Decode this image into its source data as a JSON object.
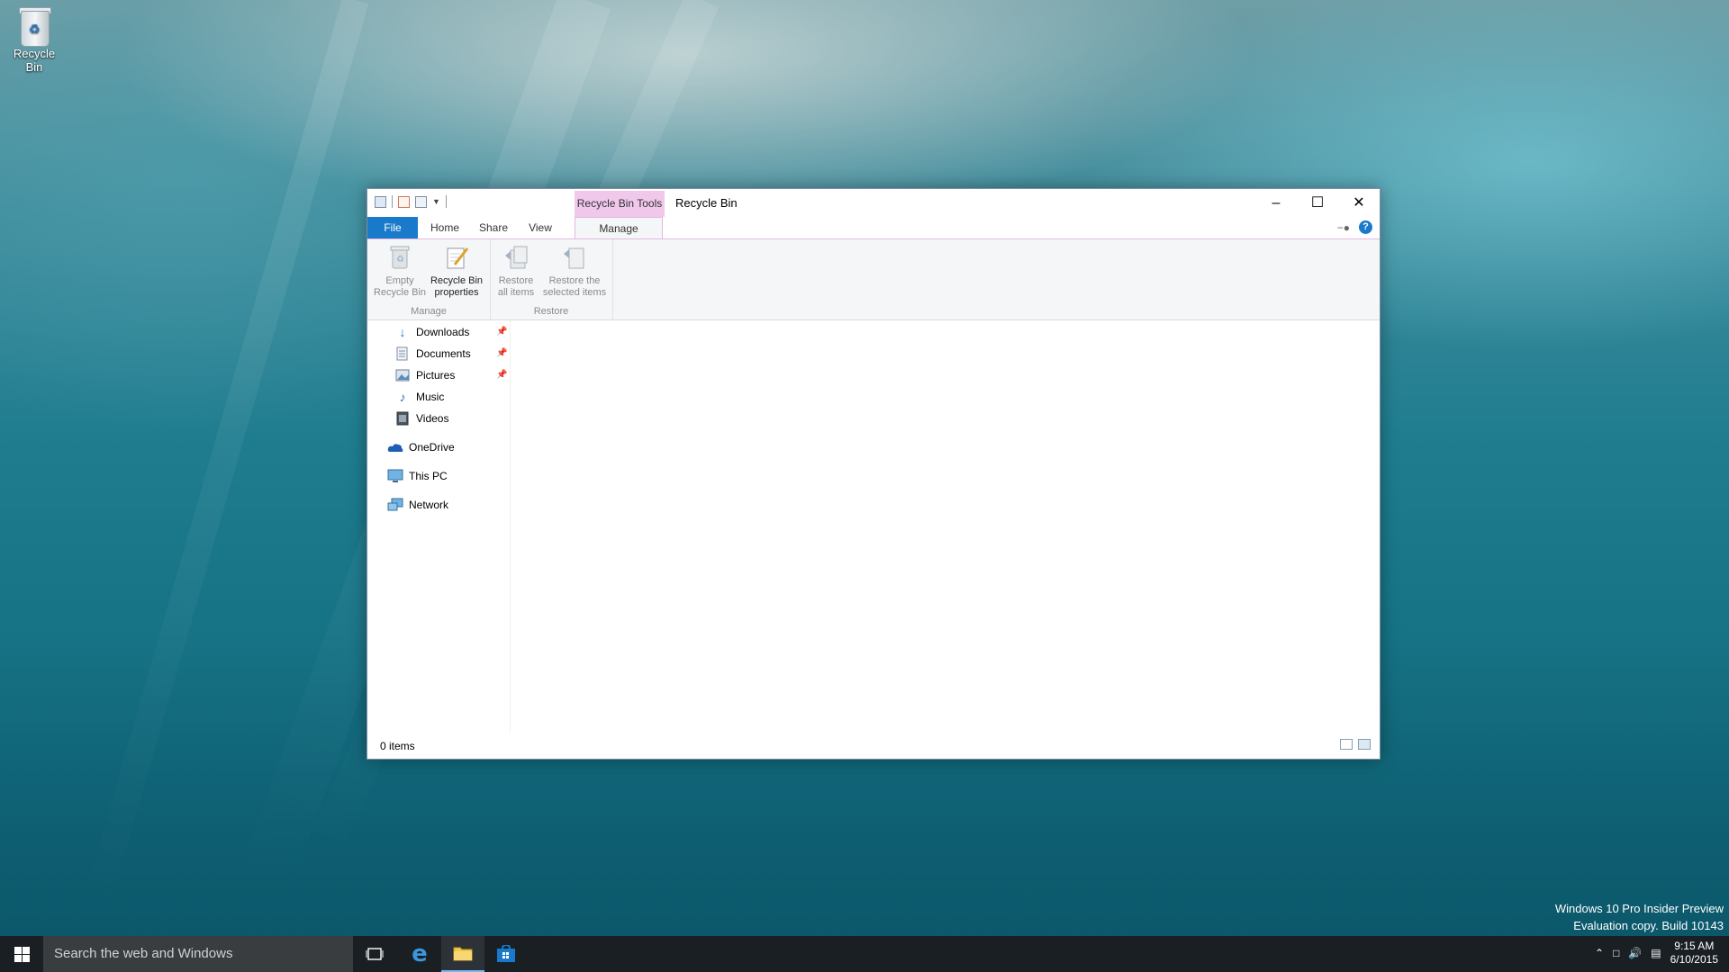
{
  "desktop": {
    "recycle_bin_label": "Recycle Bin",
    "watermark_line1": "Windows 10 Pro Insider Preview",
    "watermark_line2": "Evaluation copy. Build 10143"
  },
  "window": {
    "title": "Recycle Bin",
    "contextual_tab_group": "Recycle Bin Tools",
    "tabs": [
      "File",
      "Home",
      "Share",
      "View",
      "Manage"
    ],
    "help_label": "?",
    "ribbon": {
      "groups": [
        {
          "label": "Manage",
          "buttons": [
            {
              "line1": "Empty",
              "line2": "Recycle Bin",
              "enabled": false
            },
            {
              "line1": "Recycle Bin",
              "line2": "properties",
              "enabled": true
            }
          ]
        },
        {
          "label": "Restore",
          "buttons": [
            {
              "line1": "Restore",
              "line2": "all items",
              "enabled": false
            },
            {
              "line1": "Restore the",
              "line2": "selected items",
              "enabled": false
            }
          ]
        }
      ]
    },
    "nav": {
      "quick_access": [
        {
          "label": "Downloads",
          "icon": "download-arrow-icon",
          "pinned": true
        },
        {
          "label": "Documents",
          "icon": "documents-icon",
          "pinned": true
        },
        {
          "label": "Pictures",
          "icon": "pictures-icon",
          "pinned": true
        },
        {
          "label": "Music",
          "icon": "music-note-icon",
          "pinned": false
        },
        {
          "label": "Videos",
          "icon": "videos-icon",
          "pinned": false
        }
      ],
      "onedrive": "OneDrive",
      "this_pc": "This PC",
      "network": "Network"
    },
    "status": {
      "item_count": "0 items"
    }
  },
  "taskbar": {
    "search_placeholder": "Search the web and Windows",
    "time": "9:15 AM",
    "date": "6/10/2015"
  },
  "colors": {
    "accent": "#1979ca",
    "contextual_tab": "#f0c8ec",
    "taskbar": "#1a1f24"
  }
}
